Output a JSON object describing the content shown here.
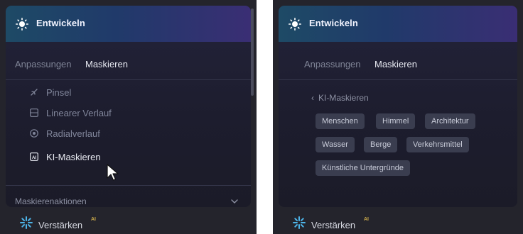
{
  "left_panel": {
    "header_title": "Entwickeln",
    "tabs": [
      {
        "label": "Anpassungen",
        "active": false
      },
      {
        "label": "Maskieren",
        "active": true
      }
    ],
    "tools": [
      {
        "label": "Pinsel",
        "icon": "brush-icon"
      },
      {
        "label": "Linearer Verlauf",
        "icon": "linear-gradient-icon"
      },
      {
        "label": "Radialverlauf",
        "icon": "radial-gradient-icon"
      },
      {
        "label": "KI-Maskieren",
        "icon": "ai-mask-icon",
        "selected": true
      }
    ],
    "section_label": "Maskierenaktionen",
    "footer_label": "Verstärken",
    "footer_badge": "AI"
  },
  "right_panel": {
    "header_title": "Entwickeln",
    "tabs": [
      {
        "label": "Anpassungen",
        "active": false
      },
      {
        "label": "Maskieren",
        "active": true
      }
    ],
    "back_label": "KI-Maskieren",
    "chips": [
      "Menschen",
      "Himmel",
      "Architektur",
      "Wasser",
      "Berge",
      "Verkehrsmittel",
      "Künstliche Untergründe"
    ],
    "footer_label": "Verstärken",
    "footer_badge": "AI"
  },
  "colors": {
    "header_start": "#1e4a66",
    "header_end": "#3a2e74",
    "panel_bg": "#24242c",
    "chip_bg": "#3a3d4f",
    "ai_badge": "#c8a84a"
  }
}
